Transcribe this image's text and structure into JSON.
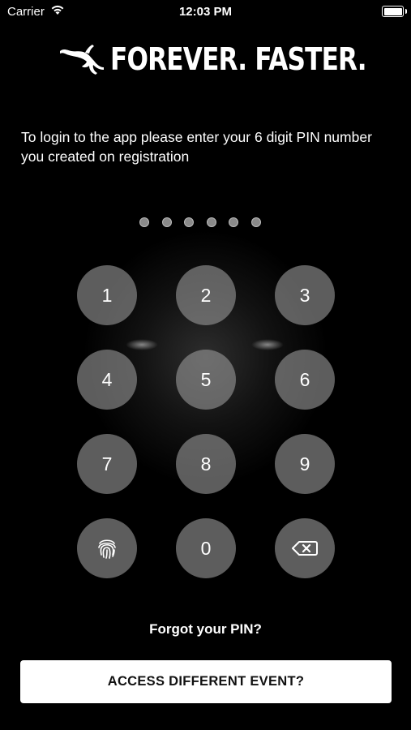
{
  "status_bar": {
    "carrier": "Carrier",
    "time": "12:03 PM"
  },
  "brand": {
    "tagline": "FOREVER. FASTER."
  },
  "instructions": "To login to the app please enter your 6 digit PIN number you created on registration",
  "pin": {
    "length": 6,
    "entered": 0
  },
  "keypad": {
    "keys": [
      "1",
      "2",
      "3",
      "4",
      "5",
      "6",
      "7",
      "8",
      "9",
      "0"
    ],
    "fingerprint_icon": "fingerprint-icon",
    "delete_icon": "backspace-icon"
  },
  "forgot_pin_label": "Forgot your PIN?",
  "access_button_label": "ACCESS DIFFERENT EVENT?"
}
